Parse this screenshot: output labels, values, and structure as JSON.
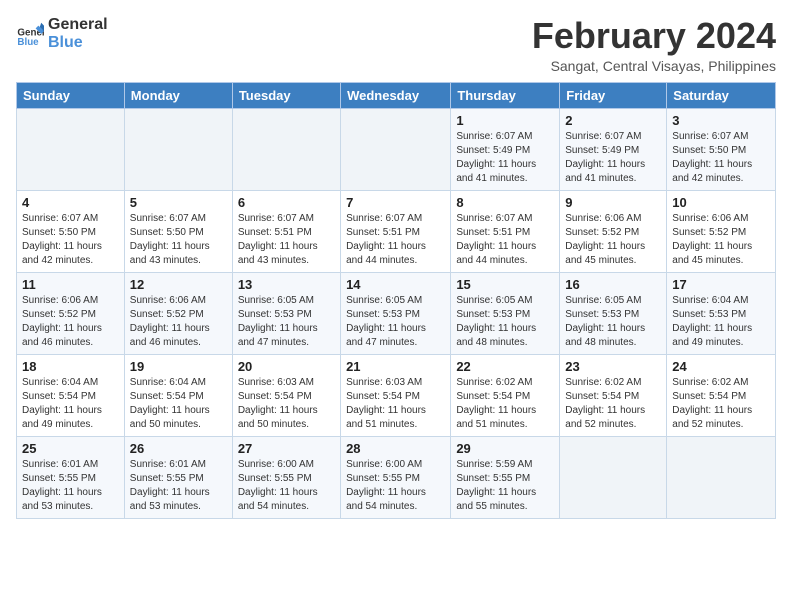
{
  "header": {
    "logo_line1": "General",
    "logo_line2": "Blue",
    "month": "February 2024",
    "location": "Sangat, Central Visayas, Philippines"
  },
  "days_of_week": [
    "Sunday",
    "Monday",
    "Tuesday",
    "Wednesday",
    "Thursday",
    "Friday",
    "Saturday"
  ],
  "weeks": [
    [
      {
        "num": "",
        "info": ""
      },
      {
        "num": "",
        "info": ""
      },
      {
        "num": "",
        "info": ""
      },
      {
        "num": "",
        "info": ""
      },
      {
        "num": "1",
        "info": "Sunrise: 6:07 AM\nSunset: 5:49 PM\nDaylight: 11 hours and 41 minutes."
      },
      {
        "num": "2",
        "info": "Sunrise: 6:07 AM\nSunset: 5:49 PM\nDaylight: 11 hours and 41 minutes."
      },
      {
        "num": "3",
        "info": "Sunrise: 6:07 AM\nSunset: 5:50 PM\nDaylight: 11 hours and 42 minutes."
      }
    ],
    [
      {
        "num": "4",
        "info": "Sunrise: 6:07 AM\nSunset: 5:50 PM\nDaylight: 11 hours and 42 minutes."
      },
      {
        "num": "5",
        "info": "Sunrise: 6:07 AM\nSunset: 5:50 PM\nDaylight: 11 hours and 43 minutes."
      },
      {
        "num": "6",
        "info": "Sunrise: 6:07 AM\nSunset: 5:51 PM\nDaylight: 11 hours and 43 minutes."
      },
      {
        "num": "7",
        "info": "Sunrise: 6:07 AM\nSunset: 5:51 PM\nDaylight: 11 hours and 44 minutes."
      },
      {
        "num": "8",
        "info": "Sunrise: 6:07 AM\nSunset: 5:51 PM\nDaylight: 11 hours and 44 minutes."
      },
      {
        "num": "9",
        "info": "Sunrise: 6:06 AM\nSunset: 5:52 PM\nDaylight: 11 hours and 45 minutes."
      },
      {
        "num": "10",
        "info": "Sunrise: 6:06 AM\nSunset: 5:52 PM\nDaylight: 11 hours and 45 minutes."
      }
    ],
    [
      {
        "num": "11",
        "info": "Sunrise: 6:06 AM\nSunset: 5:52 PM\nDaylight: 11 hours and 46 minutes."
      },
      {
        "num": "12",
        "info": "Sunrise: 6:06 AM\nSunset: 5:52 PM\nDaylight: 11 hours and 46 minutes."
      },
      {
        "num": "13",
        "info": "Sunrise: 6:05 AM\nSunset: 5:53 PM\nDaylight: 11 hours and 47 minutes."
      },
      {
        "num": "14",
        "info": "Sunrise: 6:05 AM\nSunset: 5:53 PM\nDaylight: 11 hours and 47 minutes."
      },
      {
        "num": "15",
        "info": "Sunrise: 6:05 AM\nSunset: 5:53 PM\nDaylight: 11 hours and 48 minutes."
      },
      {
        "num": "16",
        "info": "Sunrise: 6:05 AM\nSunset: 5:53 PM\nDaylight: 11 hours and 48 minutes."
      },
      {
        "num": "17",
        "info": "Sunrise: 6:04 AM\nSunset: 5:53 PM\nDaylight: 11 hours and 49 minutes."
      }
    ],
    [
      {
        "num": "18",
        "info": "Sunrise: 6:04 AM\nSunset: 5:54 PM\nDaylight: 11 hours and 49 minutes."
      },
      {
        "num": "19",
        "info": "Sunrise: 6:04 AM\nSunset: 5:54 PM\nDaylight: 11 hours and 50 minutes."
      },
      {
        "num": "20",
        "info": "Sunrise: 6:03 AM\nSunset: 5:54 PM\nDaylight: 11 hours and 50 minutes."
      },
      {
        "num": "21",
        "info": "Sunrise: 6:03 AM\nSunset: 5:54 PM\nDaylight: 11 hours and 51 minutes."
      },
      {
        "num": "22",
        "info": "Sunrise: 6:02 AM\nSunset: 5:54 PM\nDaylight: 11 hours and 51 minutes."
      },
      {
        "num": "23",
        "info": "Sunrise: 6:02 AM\nSunset: 5:54 PM\nDaylight: 11 hours and 52 minutes."
      },
      {
        "num": "24",
        "info": "Sunrise: 6:02 AM\nSunset: 5:54 PM\nDaylight: 11 hours and 52 minutes."
      }
    ],
    [
      {
        "num": "25",
        "info": "Sunrise: 6:01 AM\nSunset: 5:55 PM\nDaylight: 11 hours and 53 minutes."
      },
      {
        "num": "26",
        "info": "Sunrise: 6:01 AM\nSunset: 5:55 PM\nDaylight: 11 hours and 53 minutes."
      },
      {
        "num": "27",
        "info": "Sunrise: 6:00 AM\nSunset: 5:55 PM\nDaylight: 11 hours and 54 minutes."
      },
      {
        "num": "28",
        "info": "Sunrise: 6:00 AM\nSunset: 5:55 PM\nDaylight: 11 hours and 54 minutes."
      },
      {
        "num": "29",
        "info": "Sunrise: 5:59 AM\nSunset: 5:55 PM\nDaylight: 11 hours and 55 minutes."
      },
      {
        "num": "",
        "info": ""
      },
      {
        "num": "",
        "info": ""
      }
    ]
  ]
}
